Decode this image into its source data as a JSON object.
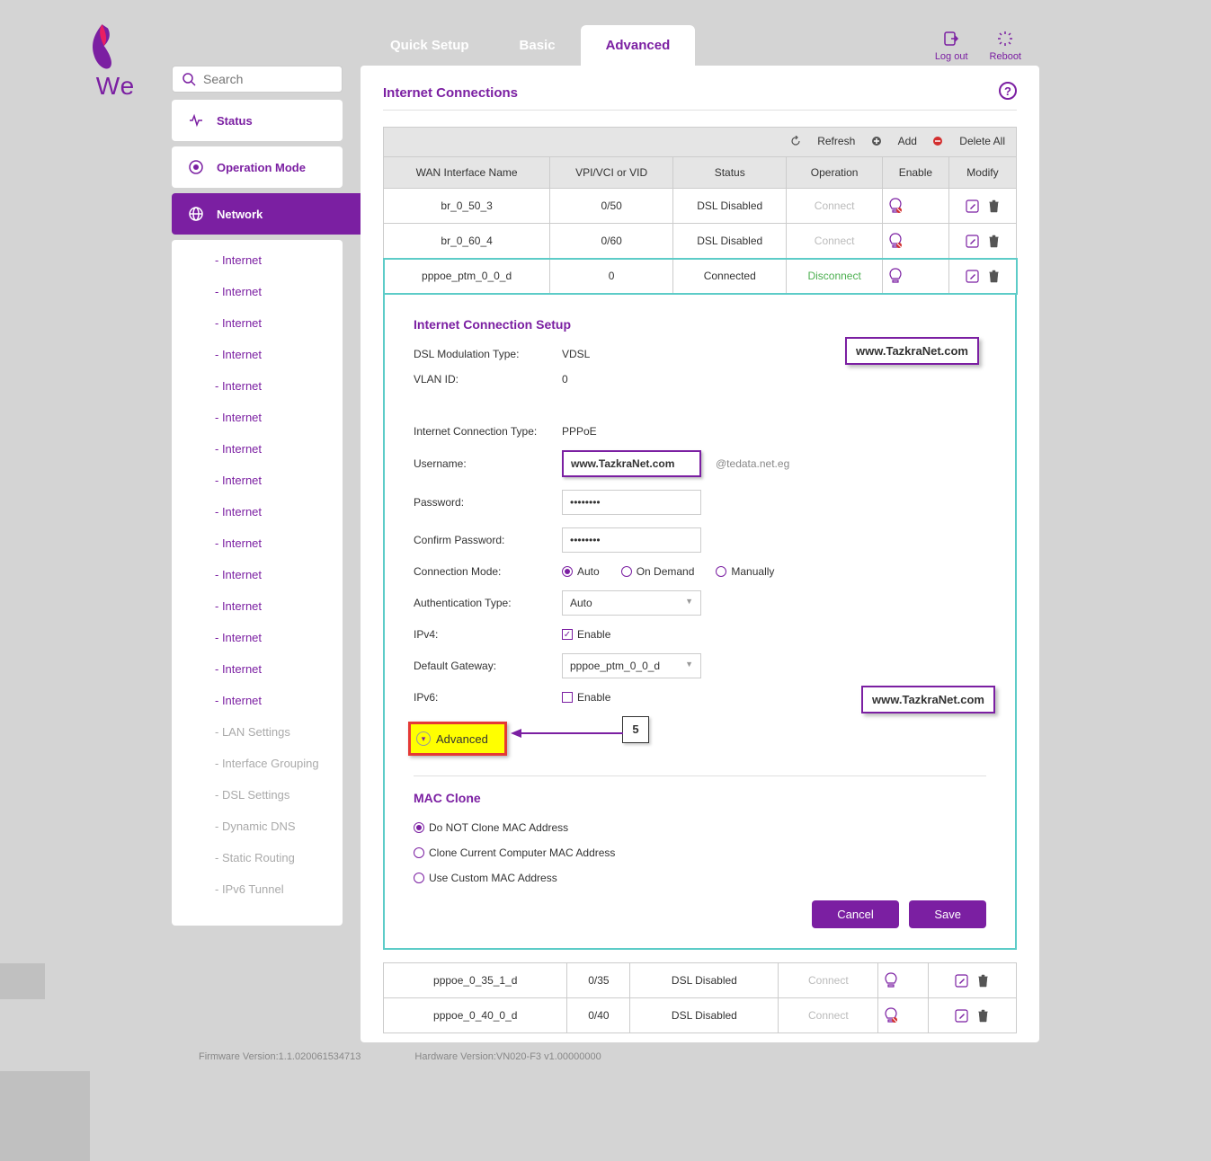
{
  "brand": {
    "name": "We"
  },
  "search": {
    "placeholder": "Search"
  },
  "top": {
    "tabs": [
      "Quick Setup",
      "Basic",
      "Advanced"
    ],
    "logout": "Log out",
    "reboot": "Reboot"
  },
  "nav": {
    "status": "Status",
    "opmode": "Operation Mode",
    "network": "Network",
    "sub": {
      "internet": "- Internet",
      "lan": "- LAN Settings",
      "ifgroup": "- Interface Grouping",
      "dsl": "- DSL Settings",
      "ddns": "- Dynamic DNS",
      "routing": "- Static Routing",
      "ipv6": "- IPv6 Tunnel"
    }
  },
  "content": {
    "title": "Internet Connections",
    "toolbar": {
      "refresh": "Refresh",
      "add": "Add",
      "delete": "Delete All"
    },
    "columns": {
      "name": "WAN Interface Name",
      "vpi": "VPI/VCI or VID",
      "status": "Status",
      "op": "Operation",
      "enable": "Enable",
      "modify": "Modify"
    },
    "rows": [
      {
        "name": "br_0_50_3",
        "vpi": "0/50",
        "status": "DSL Disabled",
        "op": "Connect",
        "enabled": false
      },
      {
        "name": "br_0_60_4",
        "vpi": "0/60",
        "status": "DSL Disabled",
        "op": "Connect",
        "enabled": false
      },
      {
        "name": "pppoe_ptm_0_0_d",
        "vpi": "0",
        "status": "Connected",
        "op": "Disconnect",
        "enabled": true
      }
    ],
    "setup": {
      "title": "Internet Connection Setup",
      "dsl_type_label": "DSL Modulation Type:",
      "dsl_type_value": "VDSL",
      "vlan_label": "VLAN ID:",
      "vlan_value": "0",
      "conn_type_label": "Internet Connection Type:",
      "conn_type_value": "PPPoE",
      "user_label": "Username:",
      "user_suffix": "@tedata.net.eg",
      "pass_label": "Password:",
      "pass_value": "••••••••",
      "confirm_label": "Confirm Password:",
      "confirm_value": "••••••••",
      "mode_label": "Connection Mode:",
      "mode_opts": [
        "Auto",
        "On Demand",
        "Manually"
      ],
      "auth_label": "Authentication Type:",
      "auth_value": "Auto",
      "ipv4_label": "IPv4:",
      "ipv4_enable": "Enable",
      "gw_label": "Default Gateway:",
      "gw_value": "pppoe_ptm_0_0_d",
      "ipv6_label": "IPv6:",
      "ipv6_enable": "Enable",
      "advanced_toggle": "Advanced",
      "mac_title": "MAC Clone",
      "mac_opts": [
        "Do NOT Clone MAC Address",
        "Clone Current Computer MAC Address",
        "Use Custom MAC Address"
      ],
      "cancel": "Cancel",
      "save": "Save"
    },
    "rows2": [
      {
        "name": "pppoe_0_35_1_d",
        "vpi": "0/35",
        "status": "DSL Disabled",
        "op": "Connect",
        "enabled": true
      },
      {
        "name": "pppoe_0_40_0_d",
        "vpi": "0/40",
        "status": "DSL Disabled",
        "op": "Connect",
        "enabled": false
      }
    ]
  },
  "footer": {
    "fw_label": "Firmware Version:",
    "fw_value": "1.1.020061534713",
    "hw_label": "Hardware Version:",
    "hw_value": "VN020-F3 v1.00000000"
  },
  "watermark": "www.TazkraNet.com",
  "annotation": {
    "step": "5"
  }
}
